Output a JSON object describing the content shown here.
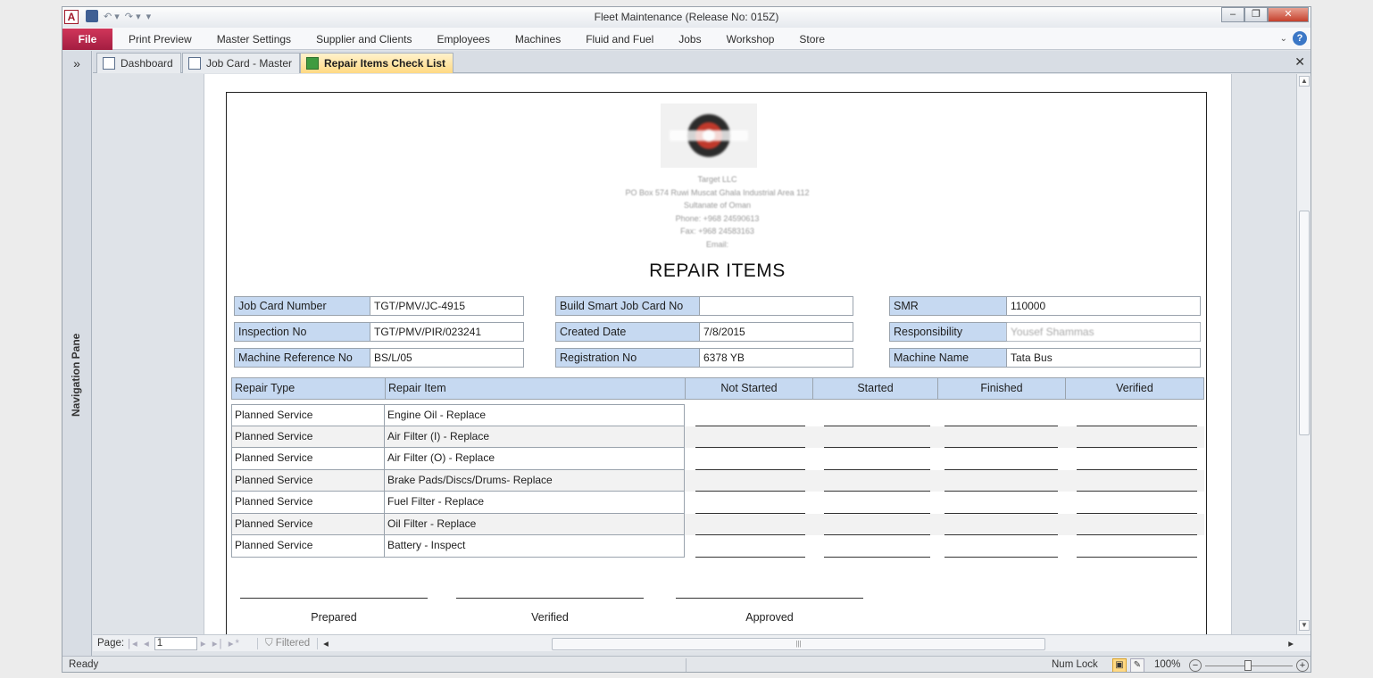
{
  "app": {
    "title": "Fleet Maintenance (Release No: 015Z)",
    "app_letter": "A",
    "file_tab": "File",
    "menus": [
      "Print Preview",
      "Master Settings",
      "Supplier and Clients",
      "Employees",
      "Machines",
      "Fluid and Fuel",
      "Jobs",
      "Workshop",
      "Store"
    ],
    "help_label": "?"
  },
  "nav_pane": {
    "label": "Navigation Pane",
    "toggle": "»"
  },
  "doc_tabs": [
    {
      "label": "Dashboard",
      "active": false
    },
    {
      "label": "Job Card - Master",
      "active": false
    },
    {
      "label": "Repair Items Check List",
      "active": true
    }
  ],
  "report": {
    "company_address": [
      "Target LLC",
      "PO Box 574 Ruwi  Muscat Ghala Industrial Area  112",
      "Sultanate of Oman",
      "Phone: +968 24590613",
      "Fax: +968 24583163",
      "Email:"
    ],
    "title": "REPAIR ITEMS",
    "fields": {
      "job_card_number": {
        "label": "Job Card Number",
        "value": "TGT/PMV/JC-4915"
      },
      "build_smart_job_card_no": {
        "label": "Build Smart Job Card No",
        "value": ""
      },
      "smr": {
        "label": "SMR",
        "value": "110000"
      },
      "inspection_no": {
        "label": "Inspection No",
        "value": "TGT/PMV/PIR/023241"
      },
      "created_date": {
        "label": "Created Date",
        "value": "7/8/2015"
      },
      "responsibility": {
        "label": "Responsibility",
        "value": "Yousef Shammas"
      },
      "machine_reference_no": {
        "label": "Machine Reference No",
        "value": "BS/L/05"
      },
      "registration_no": {
        "label": "Registration No",
        "value": "6378 YB"
      },
      "machine_name": {
        "label": "Machine Name",
        "value": "Tata Bus"
      }
    },
    "columns": [
      "Repair Type",
      "Repair Item",
      "Not Started",
      "Started",
      "Finished",
      "Verified"
    ],
    "rows": [
      {
        "type": "Planned Service",
        "item": "Engine Oil - Replace"
      },
      {
        "type": "Planned Service",
        "item": "Air Filter (I) - Replace"
      },
      {
        "type": "Planned Service",
        "item": "Air Filter (O) - Replace"
      },
      {
        "type": "Planned Service",
        "item": "Brake Pads/Discs/Drums- Replace"
      },
      {
        "type": "Planned Service",
        "item": "Fuel Filter - Replace"
      },
      {
        "type": "Planned Service",
        "item": "Oil Filter - Replace"
      },
      {
        "type": "Planned Service",
        "item": "Battery - Inspect"
      }
    ],
    "signatures": [
      "Prepared",
      "Verified",
      "Approved"
    ]
  },
  "record_nav": {
    "page_label": "Page:",
    "page_value": "1",
    "filter_label": "Filtered"
  },
  "status": {
    "ready": "Ready",
    "num_lock": "Num Lock",
    "zoom": "100%"
  },
  "colors": {
    "field_label_bg": "#c6d9f1",
    "file_tab": "#b8274a",
    "active_tab": "#ffd983"
  }
}
